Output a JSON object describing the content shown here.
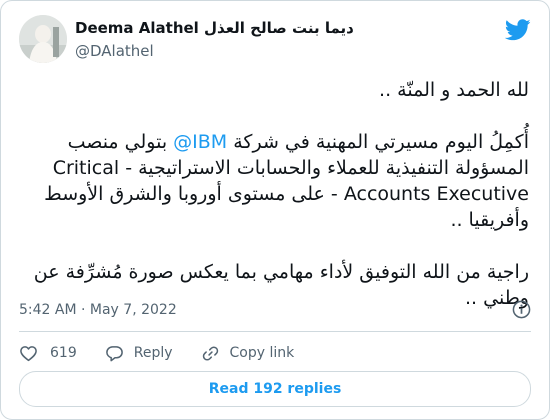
{
  "author": {
    "display_name": "Deema Alathel ديما بنت صالح العذل",
    "handle": "@DAlathel"
  },
  "tweet": {
    "line1": "لله الحمد و المنّة ..",
    "line2_prefix": "أُكمِلُ اليوم مسيرتي المهنية في شركة ",
    "mention": "@IBM",
    "line2_suffix": " بتولي منصب",
    "line3": "المسؤولة التنفيذية للعملاء والحسابات الاستراتيجية - Critical",
    "line4": "Accounts Executive - على مستوى أوروبا والشرق الأوسط",
    "line5": "وأفريقيا ..",
    "line6": "راجية من الله التوفيق لأداء مهامي بما يعكس صورة مُشرِّفة عن",
    "line7": "وطني .."
  },
  "timestamp": "5:42 AM · May 7, 2022",
  "actions": {
    "like_count": "619",
    "reply_label": "Reply",
    "copy_label": "Copy link"
  },
  "read_replies_label": "Read 192 replies",
  "colors": {
    "accent": "#1d9bf0",
    "text": "#0f1419",
    "muted": "#536471",
    "border": "#cfd9de"
  },
  "icons": [
    "avatar",
    "twitter-bird-icon",
    "info-icon",
    "heart-icon",
    "reply-icon",
    "link-icon"
  ]
}
